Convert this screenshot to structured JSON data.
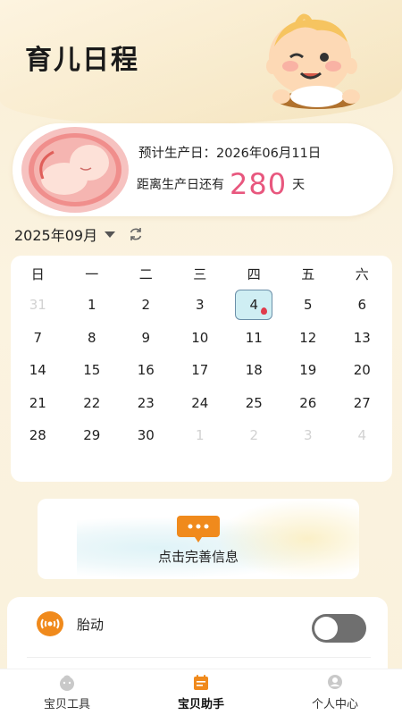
{
  "header": {
    "title": "育儿日程"
  },
  "due": {
    "label": "预计生产日：2026年06月11日",
    "remaining_prefix": "距离生产日还有",
    "remaining_days": "280",
    "remaining_suffix": "天"
  },
  "calendar": {
    "month_label": "2025年09月",
    "weekdays": [
      "日",
      "一",
      "二",
      "三",
      "四",
      "五",
      "六"
    ],
    "days": [
      "31",
      "1",
      "2",
      "3",
      "4",
      "5",
      "6",
      "7",
      "8",
      "9",
      "10",
      "11",
      "12",
      "13",
      "14",
      "15",
      "16",
      "17",
      "18",
      "19",
      "20",
      "21",
      "22",
      "23",
      "24",
      "25",
      "26",
      "27",
      "28",
      "29",
      "30",
      "1",
      "2",
      "3",
      "4"
    ],
    "muted_indices": [
      0,
      31,
      32,
      33,
      34
    ],
    "today_index": 4
  },
  "info_card": {
    "text": "点击完善信息"
  },
  "panel": {
    "fetal_movement_label": "胎动",
    "toggle_on": false
  },
  "tabs": [
    {
      "label": "宝贝工具",
      "icon": "baby-face-icon",
      "active": false
    },
    {
      "label": "宝贝助手",
      "icon": "calendar-icon",
      "active": true
    },
    {
      "label": "个人中心",
      "icon": "profile-icon",
      "active": false
    }
  ],
  "colors": {
    "accent_pink": "#e8577e",
    "accent_orange": "#f08a1c",
    "background": "#f9efd6",
    "today_fill": "#cfeef3"
  }
}
